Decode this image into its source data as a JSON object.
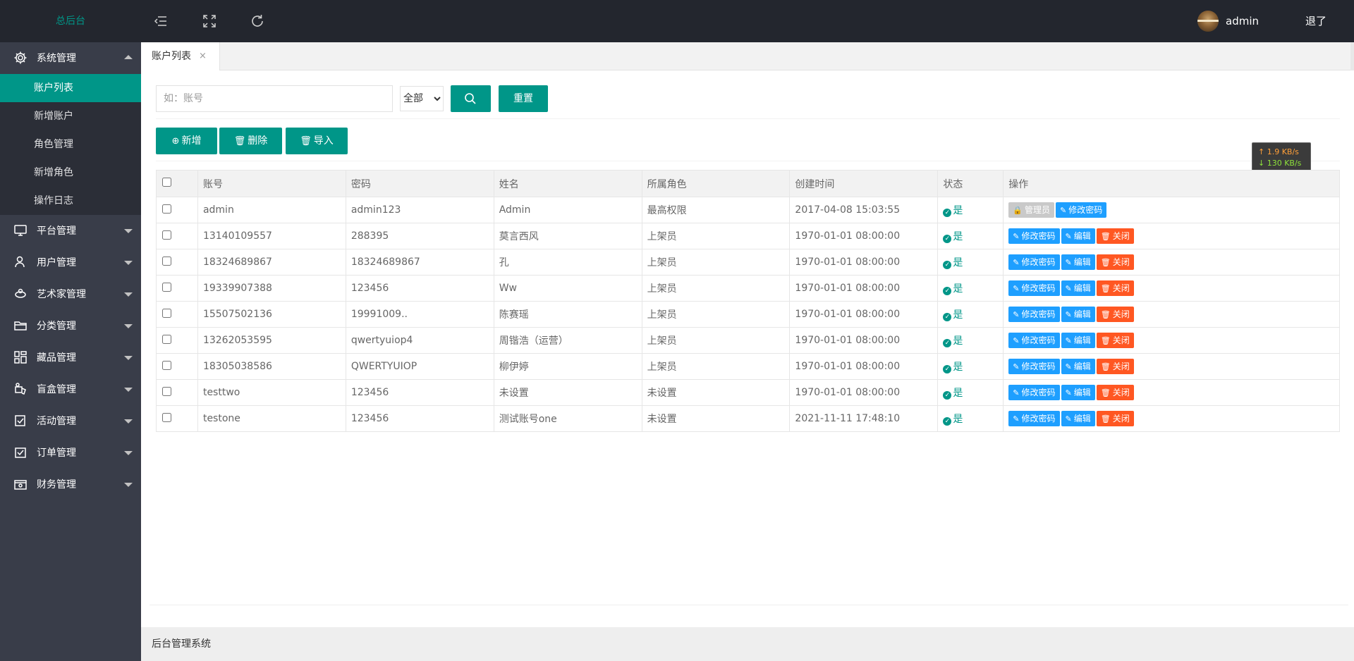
{
  "header": {
    "logo": "总后台",
    "menu_icon": "menu-fold-icon",
    "fullscreen_icon": "fullscreen-icon",
    "refresh_icon": "refresh-icon",
    "username": "admin",
    "logout": "退了"
  },
  "sidebar": {
    "groups": [
      {
        "label": "系统管理",
        "icon": "gear-icon",
        "open": true,
        "items": [
          "账户列表",
          "新增账户",
          "角色管理",
          "新增角色",
          "操作日志"
        ]
      },
      {
        "label": "平台管理",
        "icon": "monitor-icon"
      },
      {
        "label": "用户管理",
        "icon": "user-icon"
      },
      {
        "label": "艺术家管理",
        "icon": "artist-icon"
      },
      {
        "label": "分类管理",
        "icon": "folder-icon"
      },
      {
        "label": "藏品管理",
        "icon": "grid-icon"
      },
      {
        "label": "盲盒管理",
        "icon": "box-icon"
      },
      {
        "label": "活动管理",
        "icon": "activity-icon"
      },
      {
        "label": "订单管理",
        "icon": "order-icon"
      },
      {
        "label": "财务管理",
        "icon": "finance-icon"
      }
    ]
  },
  "tabs": [
    {
      "label": "账户列表",
      "close": "×"
    }
  ],
  "search": {
    "placeholder": "如：账号",
    "select_value": "全部",
    "reset_label": "重置"
  },
  "toolbar": {
    "add_label": "新增",
    "delete_label": "删除",
    "import_label": "导入"
  },
  "speed": {
    "up": "↑ 1.9 KB/s",
    "down": "↓ 130 KB/s"
  },
  "table": {
    "columns": [
      "账号",
      "密码",
      "姓名",
      "所属角色",
      "创建时间",
      "状态",
      "操作"
    ],
    "rows": [
      [
        "admin",
        "admin123",
        "Admin",
        "最高权限",
        "2017-04-08 15:03:55",
        "是"
      ],
      [
        "13140109557",
        "288395",
        "莫言西风",
        "上架员",
        "1970-01-01 08:00:00",
        "是"
      ],
      [
        "18324689867",
        "18324689867",
        "孔",
        "上架员",
        "1970-01-01 08:00:00",
        "是"
      ],
      [
        "19339907388",
        "123456",
        "Ww",
        "上架员",
        "1970-01-01 08:00:00",
        "是"
      ],
      [
        "15507502136",
        "19991009..",
        "陈赛瑶",
        "上架员",
        "1970-01-01 08:00:00",
        "是"
      ],
      [
        "13262053595",
        "qwertyuiop4",
        "周锴浩（运营）",
        "上架员",
        "1970-01-01 08:00:00",
        "是"
      ],
      [
        "18305038586",
        "QWERTYUIOP",
        "柳伊婷",
        "上架员",
        "1970-01-01 08:00:00",
        "是"
      ],
      [
        "testtwo",
        "123456",
        "未设置",
        "未设置",
        "1970-01-01 08:00:00",
        "是"
      ],
      [
        "testone",
        "123456",
        "测试账号one",
        "未设置",
        "2021-11-11 17:48:10",
        "是"
      ]
    ],
    "admin_actions": [
      "管理员",
      "修改密码"
    ],
    "actions": [
      "修改密码",
      "编辑",
      "关闭"
    ]
  },
  "footer": "后台管理系统",
  "colors": {
    "accent": "#009688",
    "header": "#23262e",
    "sidebar": "#393d49",
    "blue": "#1e9fff",
    "red": "#ff5722"
  }
}
